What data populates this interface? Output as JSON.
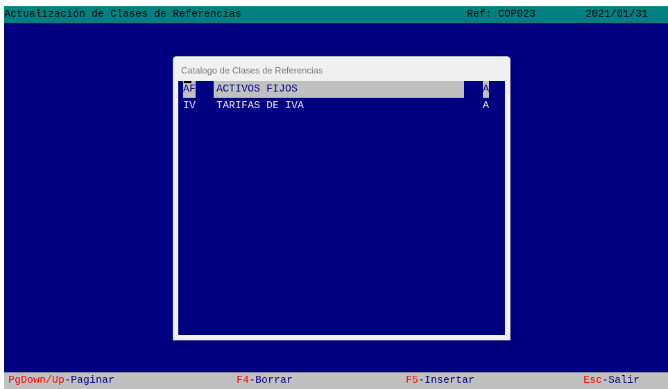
{
  "header": {
    "title": "Actualización de Clases de Referencias",
    "ref": "Ref: COP023",
    "date": "2021/01/31"
  },
  "dialog": {
    "title": "Catalogo de Clases de Referencias",
    "rows": [
      {
        "code": "AF",
        "name": "ACTIVOS FIJOS",
        "status": "A",
        "selected": true
      },
      {
        "code": "IV",
        "name": "TARIFAS DE IVA",
        "status": "A",
        "selected": false
      }
    ]
  },
  "footer": {
    "hints": [
      {
        "key": "PgDown/Up",
        "label": "-Paginar"
      },
      {
        "key": "F4",
        "label": "-Borrar"
      },
      {
        "key": "F5",
        "label": "-Insertar"
      },
      {
        "key": "Esc",
        "label": "-Salir"
      }
    ]
  },
  "colors": {
    "background": "#000080",
    "titlebar": "#008080",
    "selection": "#c0c0c0",
    "key_text": "#ff0000"
  }
}
